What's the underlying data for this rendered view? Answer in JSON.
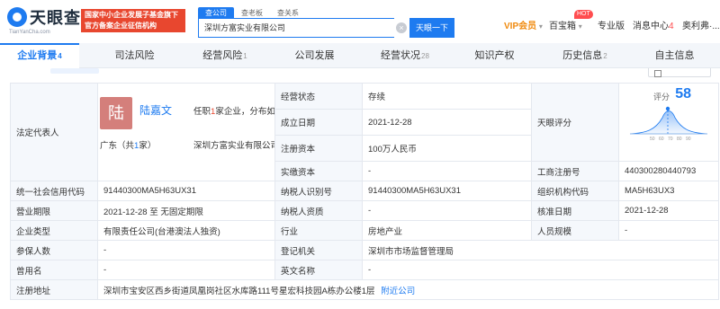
{
  "header": {
    "logo_text": "天眼查",
    "logo_sub": "TianYanCha.com",
    "promo_line1": "国家中小企业发展子基金旗下",
    "promo_line2": "官方备案企业征信机构",
    "search_tabs": [
      "查公司",
      "查老板",
      "查关系"
    ],
    "search_value": "深圳方富实业有限公司",
    "search_button": "天眼一下",
    "nav": {
      "vip": "VIP会员",
      "baibaoxiang": "百宝箱",
      "hot1": "HOT",
      "pro": "专业版",
      "messages": "消息中心",
      "messages_count": "4",
      "user": "奥利弗·..."
    }
  },
  "tabs": [
    {
      "label": "企业背景",
      "count": "4"
    },
    {
      "label": "司法风险",
      "count": ""
    },
    {
      "label": "经营风险",
      "count": "1"
    },
    {
      "label": "公司发展",
      "count": ""
    },
    {
      "label": "经营状况",
      "count": "28"
    },
    {
      "label": "知识产权",
      "count": ""
    },
    {
      "label": "历史信息",
      "count": "2"
    },
    {
      "label": "自主信息",
      "count": ""
    }
  ],
  "legal_rep": {
    "label": "法定代表人",
    "avatar_char": "陆",
    "name": "陆嘉文",
    "desc_prefix": "任职",
    "desc_count": "1",
    "desc_suffix": "家企业，分布如下",
    "region_prefix": "广东（共",
    "region_count": "1",
    "region_suffix": "家）",
    "company": "深圳方富实业有限公司"
  },
  "score": {
    "label": "天眼评分",
    "value": "58",
    "axis_ticks": [
      "50",
      "60",
      "70",
      "80",
      "90"
    ]
  },
  "fields": {
    "status_label": "经营状态",
    "status_value": "存续",
    "founded_label": "成立日期",
    "founded_value": "2021-12-28",
    "capital_label": "注册资本",
    "capital_value": "100万人民币",
    "paid_label": "实缴资本",
    "paid_value": "-",
    "regno_label": "工商注册号",
    "regno_value": "440300280440793",
    "credit_label": "统一社会信用代码",
    "credit_value": "91440300MA5H63UX31",
    "taxid_label": "纳税人识别号",
    "taxid_value": "91440300MA5H63UX31",
    "orgcode_label": "组织机构代码",
    "orgcode_value": "MA5H63UX3",
    "term_label": "营业期限",
    "term_value": "2021-12-28 至 无固定期限",
    "taxqual_label": "纳税人资质",
    "taxqual_value": "-",
    "approve_label": "核准日期",
    "approve_value": "2021-12-28",
    "type_label": "企业类型",
    "type_value": "有限责任公司(台港澳法人独资)",
    "industry_label": "行业",
    "industry_value": "房地产业",
    "staff_label": "人员规模",
    "staff_value": "-",
    "insured_label": "参保人数",
    "insured_value": "-",
    "authority_label": "登记机关",
    "authority_value": "深圳市市场监督管理局",
    "former_label": "曾用名",
    "former_value": "-",
    "english_label": "英文名称",
    "english_value": "-",
    "address_label": "注册地址",
    "address_value": "深圳市宝安区西乡街道凤凰岗社区水库路111号星宏科技园A栋办公楼1层",
    "nearby_link": "附近公司"
  },
  "colors": {
    "accent": "#1e7bf0",
    "promo": "#e8472f",
    "avatar": "#d47f7b",
    "label_bg": "#f5f8fc"
  }
}
